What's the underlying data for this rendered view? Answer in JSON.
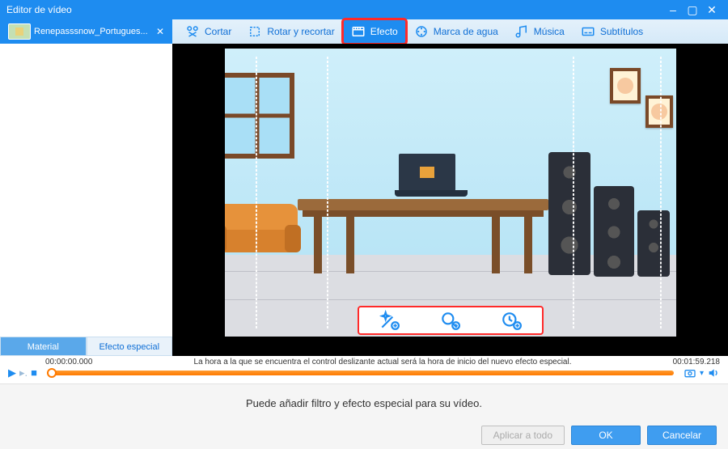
{
  "window": {
    "title": "Editor de vídeo"
  },
  "file_tab": {
    "label": "Renepasssnow_Portugues..."
  },
  "toolbar": {
    "cut": "Cortar",
    "rotate": "Rotar y recortar",
    "effect": "Efecto",
    "watermark": "Marca de agua",
    "music": "Música",
    "subtitles": "Subtítulos",
    "active": "effect"
  },
  "sidebar_tabs": {
    "material": "Material",
    "special_effect": "Efecto especial",
    "active": "material"
  },
  "timeline": {
    "start": "00:00:00.000",
    "end": "00:01:59.218",
    "hint": "La hora a la que se encuentra el control deslizante actual será la hora de inicio del nuevo efecto especial."
  },
  "bottom": {
    "hint": "Puede añadir filtro y efecto especial para su vídeo.",
    "apply_all": "Aplicar a todo",
    "ok": "OK",
    "cancel": "Cancelar"
  }
}
